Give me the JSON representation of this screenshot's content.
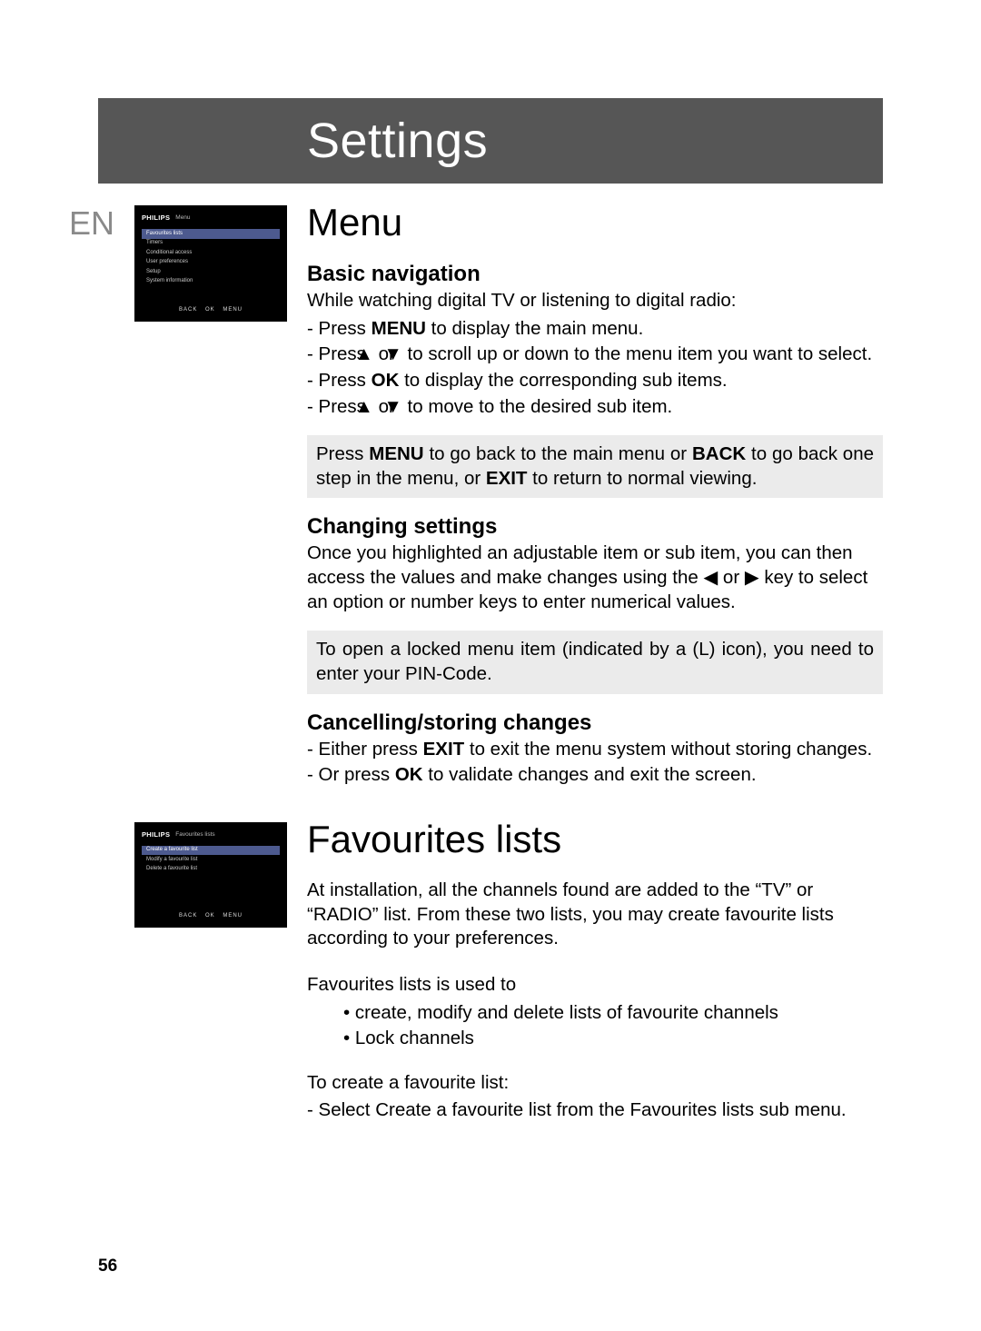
{
  "header_title": "Settings",
  "lang_code": "EN",
  "page_number": "56",
  "screenshot1": {
    "brand": "PHILIPS",
    "title": "Menu",
    "items": [
      "Favourites lists",
      "Timers",
      "Conditional access",
      "User preferences",
      "Setup",
      "System information"
    ],
    "footer": "BACK   OK   MENU"
  },
  "screenshot2": {
    "brand": "PHILIPS",
    "title": "Favourites lists",
    "items": [
      "Create a favourite list",
      "Modify a favourite list",
      "Delete a favourite list"
    ],
    "footer": "BACK   OK   MENU"
  },
  "menu_heading": "Menu",
  "basic_nav_heading": "Basic navigation",
  "basic_nav_intro": "While watching digital TV or listening to digital radio:",
  "nav_l1a": "-  Press ",
  "nav_l1b": "MENU",
  "nav_l1c": " to display the main menu.",
  "nav_l2a": "-  Press ",
  "nav_l2b": " or ",
  "nav_l2c": " to scroll up or down to the menu item you want to select.",
  "nav_l3a": "-  Press ",
  "nav_l3b": "OK",
  "nav_l3c": " to display the corresponding sub items.",
  "nav_l4a": "-  Press ",
  "nav_l4b": " or ",
  "nav_l4c": " to move to the desired sub item.",
  "note1_a": "Press ",
  "note1_b": "MENU",
  "note1_c": " to go back to the main menu or ",
  "note1_d": "BACK",
  "note1_e": " to go back one step in the menu, or ",
  "note1_f": "EXIT",
  "note1_g": " to return to normal viewing.",
  "chg_heading": "Changing settings",
  "chg_a": "Once you highlighted an adjustable item or sub item, you can then access the values and make changes using the ",
  "chg_b": " or ",
  "chg_c": "  key to select an option or number keys to enter numerical values.",
  "note2": "To open a locked menu item (indicated by a (L) icon), you need to enter your PIN-Code.",
  "cancel_heading": "Cancelling/storing changes",
  "cancel_l1a": "-  Either press ",
  "cancel_l1b": "EXIT",
  "cancel_l1c": " to exit the menu system without storing changes.",
  "cancel_l2a": "-  Or press ",
  "cancel_l2b": "OK",
  "cancel_l2c": " to validate changes and exit the screen.",
  "fav_heading": "Favourites lists",
  "fav_p1": "At installation, all the channels found are added to the “TV” or “RADIO” list. From these two lists, you may create favourite lists according to your preferences.",
  "fav_p2": "Favourites lists is used to",
  "fav_b1": "•  create, modify and delete lists of favourite channels",
  "fav_b2": "•  Lock channels",
  "fav_p3": "To create a favourite list:",
  "fav_l1": "-  Select Create a favourite list from the Favourites lists sub menu.",
  "arrows": {
    "up": "▲",
    "down": "▼",
    "left": "◀",
    "right": "▶"
  }
}
